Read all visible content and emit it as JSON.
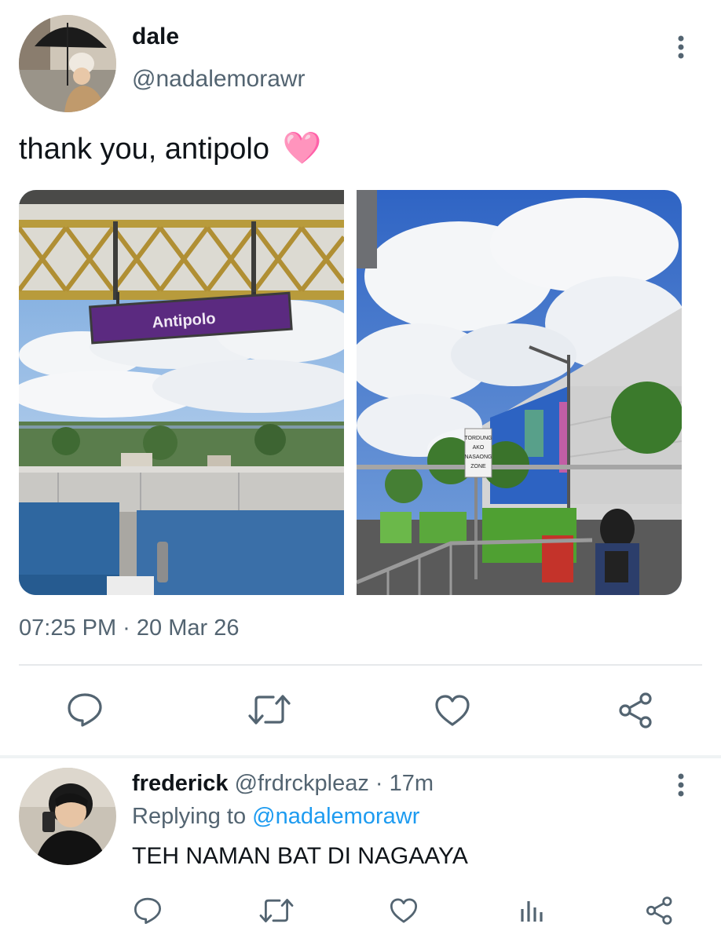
{
  "tweet": {
    "display_name": "dale",
    "handle": "@nadalemorawr",
    "text": "thank you, antipolo",
    "emoji": "🩷",
    "photo1_sign": "Antipolo",
    "photo2_sign": [
      "TORDUNG",
      "AKO",
      "NASAONG",
      "ZONE"
    ],
    "timestamp": "07:25 PM · 20 Mar 26",
    "icons": [
      "comment-icon",
      "retweet-icon",
      "heart-icon",
      "share-icon",
      "more-vertical-icon"
    ]
  },
  "reply": {
    "display_name": "frederick",
    "handle": "@frdrckpleaz",
    "separator": "·",
    "time": "17m",
    "replying_prefix": "Replying to",
    "replying_handle": "@nadalemorawr",
    "text": "TEH NAMAN BAT DI NAGAAYA",
    "icons": [
      "comment-icon",
      "retweet-icon",
      "heart-icon",
      "views-icon",
      "share-icon",
      "more-vertical-icon"
    ]
  },
  "colors": {
    "text": "#0f1419",
    "muted": "#536471",
    "link": "#1d9bf0",
    "divider": "#e6e9eb",
    "sign_purple": "#5b2a80"
  }
}
